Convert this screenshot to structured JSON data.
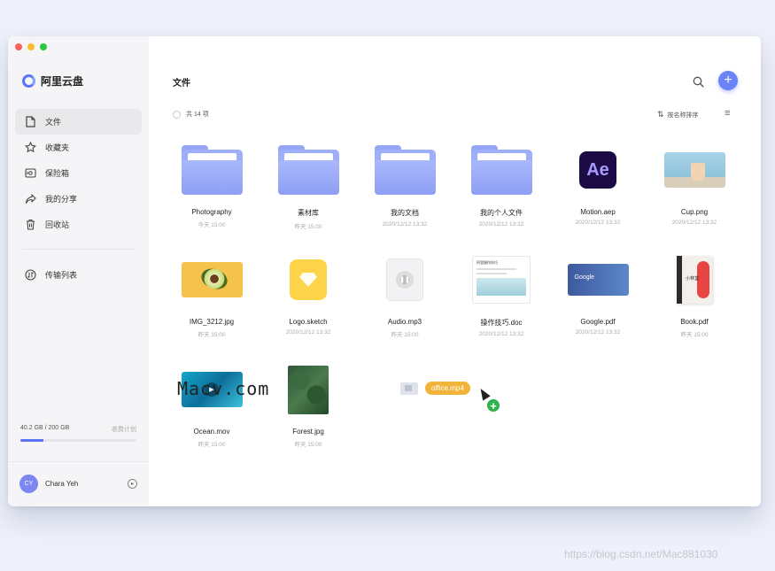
{
  "app": {
    "name": "阿里云盘"
  },
  "nav": {
    "items": [
      {
        "label": "文件",
        "icon": "file-icon"
      },
      {
        "label": "收藏夹",
        "icon": "star-icon"
      },
      {
        "label": "保险箱",
        "icon": "safe-icon"
      },
      {
        "label": "我的分享",
        "icon": "share-icon"
      },
      {
        "label": "回收站",
        "icon": "trash-icon"
      }
    ],
    "transfer": {
      "label": "传输列表",
      "icon": "transfer-icon"
    }
  },
  "storage": {
    "used_text": "40.2 GB / 200 GB",
    "plan_label": "收费计划",
    "used_fraction": 0.201
  },
  "user": {
    "initials": "CY",
    "name": "Chara Yeh"
  },
  "main": {
    "title": "文件",
    "count_label": "共 14 项",
    "sort_label": "按名称排序"
  },
  "files": [
    {
      "name": "Photography",
      "date": "今天 15:00",
      "kind": "folder"
    },
    {
      "name": "素材库",
      "date": "昨天 15:00",
      "kind": "folder"
    },
    {
      "name": "我的文档",
      "date": "2020/12/12 13:32",
      "kind": "folder"
    },
    {
      "name": "我的个人文件",
      "date": "2020/12/12 13:32",
      "kind": "folder"
    },
    {
      "name": "Motion.aep",
      "date": "2020/12/12 13:32",
      "kind": "ae",
      "glyph": "Ae"
    },
    {
      "name": "Cup.png",
      "date": "2020/12/12 13:32",
      "kind": "cup"
    },
    {
      "name": "IMG_3212.jpg",
      "date": "昨天 15:00",
      "kind": "avocado"
    },
    {
      "name": "Logo.sketch",
      "date": "2020/12/12 13:32",
      "kind": "sketch"
    },
    {
      "name": "Audio.mp3",
      "date": "昨天 15:00",
      "kind": "audio"
    },
    {
      "name": "操作技巧.doc",
      "date": "2020/12/12 13:32",
      "kind": "doc",
      "doc_heading": "阿里操作技巧"
    },
    {
      "name": "Google.pdf",
      "date": "2020/12/12 13:32",
      "kind": "google"
    },
    {
      "name": "Book.pdf",
      "date": "昨天 15:00",
      "kind": "book",
      "book_title": "小林堂"
    },
    {
      "name": "Ocean.mov",
      "date": "昨天 15:00",
      "kind": "pool"
    },
    {
      "name": "Forest.jpg",
      "date": "昨天 15:00",
      "kind": "forest"
    }
  ],
  "drag": {
    "label": "office.mp4"
  },
  "overlay": {
    "watermark": "Macv.com",
    "credit": "https://blog.csdn.net/Mac881030"
  },
  "colors": {
    "accent": "#6a84f8",
    "drag_label": "#f2b33a",
    "add_badge": "#2fb24c"
  }
}
